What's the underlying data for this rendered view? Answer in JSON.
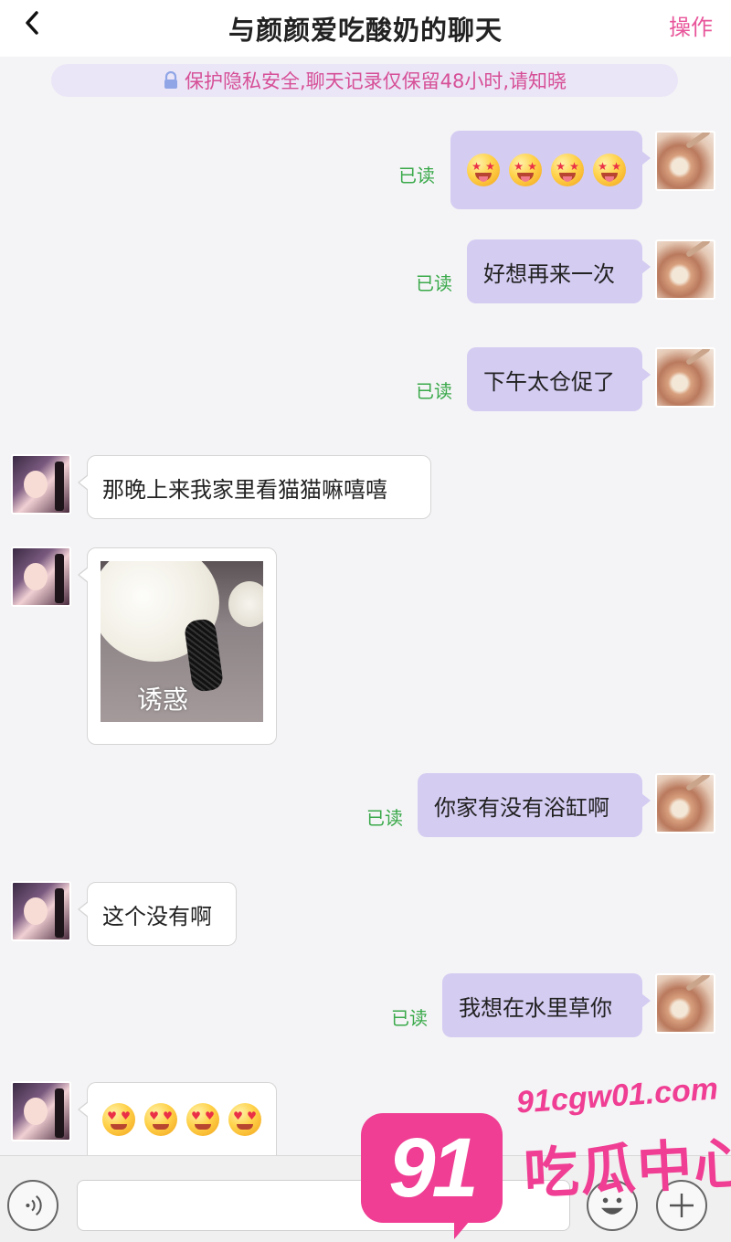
{
  "header": {
    "title": "与颜颜爱吃酸奶的聊天",
    "action_label": "操作"
  },
  "notice": {
    "text": "保护隐私安全,聊天记录仅保留48小时,请知晓"
  },
  "messages": [
    {
      "from": "me",
      "type": "emoji",
      "emoji": "star-struck-face",
      "count": 4,
      "read_label": "已读"
    },
    {
      "from": "me",
      "type": "text",
      "text": "好想再来一次",
      "read_label": "已读"
    },
    {
      "from": "me",
      "type": "text",
      "text": "下午太仓促了",
      "read_label": "已读"
    },
    {
      "from": "her",
      "type": "text",
      "text": "那晚上来我家里看猫猫嘛嘻嘻"
    },
    {
      "from": "her",
      "type": "image",
      "image_caption": "诱惑"
    },
    {
      "from": "me",
      "type": "text",
      "text": "你家有没有浴缸啊",
      "read_label": "已读"
    },
    {
      "from": "her",
      "type": "text",
      "text": "这个没有啊"
    },
    {
      "from": "me",
      "type": "text",
      "text": "我想在水里草你",
      "read_label": "已读"
    },
    {
      "from": "her",
      "type": "emoji",
      "emoji": "heart-eyes-face",
      "count": 4
    }
  ],
  "input_bar": {
    "voice_icon": "voice-icon",
    "emoji_icon": "smiley-icon",
    "plus_icon": "plus-icon",
    "input_value": ""
  },
  "watermark": {
    "badge": "91",
    "url": "91cgw01.com",
    "name": "吃瓜中心"
  },
  "colors": {
    "accent": "#e8559a",
    "my_bubble": "#d5ccf2",
    "read_status": "#3aa94a",
    "watermark": "#ef3e93"
  }
}
